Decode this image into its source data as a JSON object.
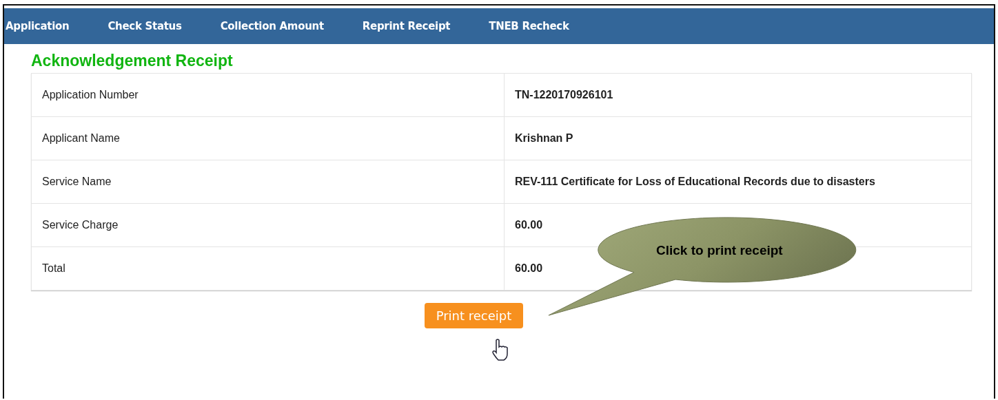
{
  "nav": [
    {
      "label": "Application"
    },
    {
      "label": "Check Status"
    },
    {
      "label": "Collection Amount"
    },
    {
      "label": "Reprint Receipt"
    },
    {
      "label": "TNEB Recheck"
    }
  ],
  "heading": "Acknowledgement Receipt",
  "rows": [
    {
      "label": "Application Number",
      "value": "TN-1220170926101"
    },
    {
      "label": "Applicant Name",
      "value": "Krishnan P"
    },
    {
      "label": "Service Name",
      "value": "REV-111 Certificate for Loss of Educational Records due to disasters"
    },
    {
      "label": "Service Charge",
      "value": "60.00"
    },
    {
      "label": "Total",
      "value": "60.00"
    }
  ],
  "button": "Print receipt",
  "callout": "Click to print receipt"
}
